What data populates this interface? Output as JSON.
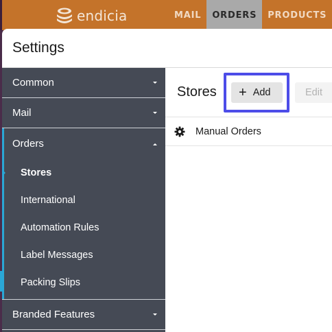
{
  "app": {
    "logo_text": "endicia",
    "nav": [
      {
        "label": "MAIL",
        "active": false
      },
      {
        "label": "ORDERS",
        "active": true
      },
      {
        "label": "PRODUCTS",
        "active": false
      }
    ]
  },
  "settings": {
    "title": "Settings",
    "sidebar": {
      "common": "Common",
      "mail": "Mail",
      "orders": "Orders",
      "orders_items": [
        "Stores",
        "International",
        "Automation Rules",
        "Label Messages",
        "Packing Slips"
      ],
      "active_item": "Stores",
      "branded": "Branded Features"
    },
    "main": {
      "title": "Stores",
      "add_label": "Add",
      "edit_label": "Edit",
      "stores": [
        {
          "name": "Manual Orders",
          "icon": "gear-icon"
        }
      ]
    }
  },
  "colors": {
    "topbar": "#c4732a",
    "sidebar": "#454a55",
    "accent": "#2aa7d6",
    "highlight": "#4d4de8"
  }
}
